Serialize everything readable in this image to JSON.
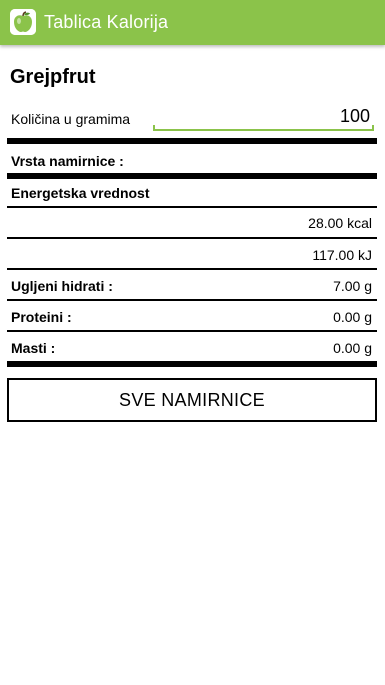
{
  "app_bar": {
    "title": "Tablica Kalorija",
    "icon": "apple-icon",
    "color": "#8bc34a"
  },
  "food": {
    "name": "Grejpfrut"
  },
  "quantity": {
    "label": "Količina u gramima",
    "value": "100"
  },
  "rows": {
    "type_label": "Vrsta namirnice :",
    "energy_label": "Energetska vrednost",
    "kcal_value": "28.00 kcal",
    "kj_value": "117.00 kJ",
    "carbs_label": "Ugljeni hidrati :",
    "carbs_value": "7.00 g",
    "protein_label": "Proteini :",
    "protein_value": "0.00 g",
    "fat_label": "Masti :",
    "fat_value": "0.00 g"
  },
  "button": {
    "label": "SVE NAMIRNICE"
  }
}
